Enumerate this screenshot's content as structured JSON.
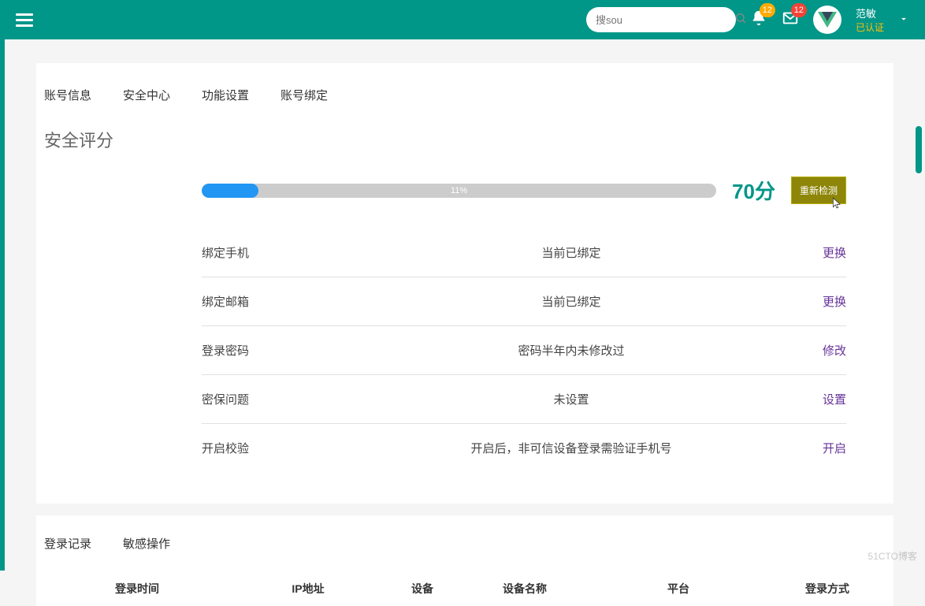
{
  "header": {
    "search_placeholder": "搜sou",
    "bell_badge": "12",
    "mail_badge": "12",
    "username": "范敏",
    "verified": "已认证"
  },
  "tabs": {
    "account_info": "账号信息",
    "security_center": "安全中心",
    "feature_settings": "功能设置",
    "account_binding": "账号绑定"
  },
  "section_title": "安全评分",
  "progress": {
    "percent_label": "11%",
    "fill_width_percent": 11
  },
  "score": "70分",
  "recheck_label": "重新检测",
  "security_items": [
    {
      "label": "绑定手机",
      "status": "当前已绑定",
      "action": "更换"
    },
    {
      "label": "绑定邮箱",
      "status": "当前已绑定",
      "action": "更换"
    },
    {
      "label": "登录密码",
      "status": "密码半年内未修改过",
      "action": "修改"
    },
    {
      "label": "密保问题",
      "status": "未设置",
      "action": "设置"
    },
    {
      "label": "开启校验",
      "status": "开启后，非可信设备登录需验证手机号",
      "action": "开启"
    }
  ],
  "tabs2": {
    "login_records": "登录记录",
    "sensitive_ops": "敏感操作"
  },
  "table_headers": {
    "login_time": "登录时间",
    "ip_address": "IP地址",
    "device": "设备",
    "device_name": "设备名称",
    "platform": "平台",
    "login_method": "登录方式"
  },
  "watermark": "51CTO博客"
}
